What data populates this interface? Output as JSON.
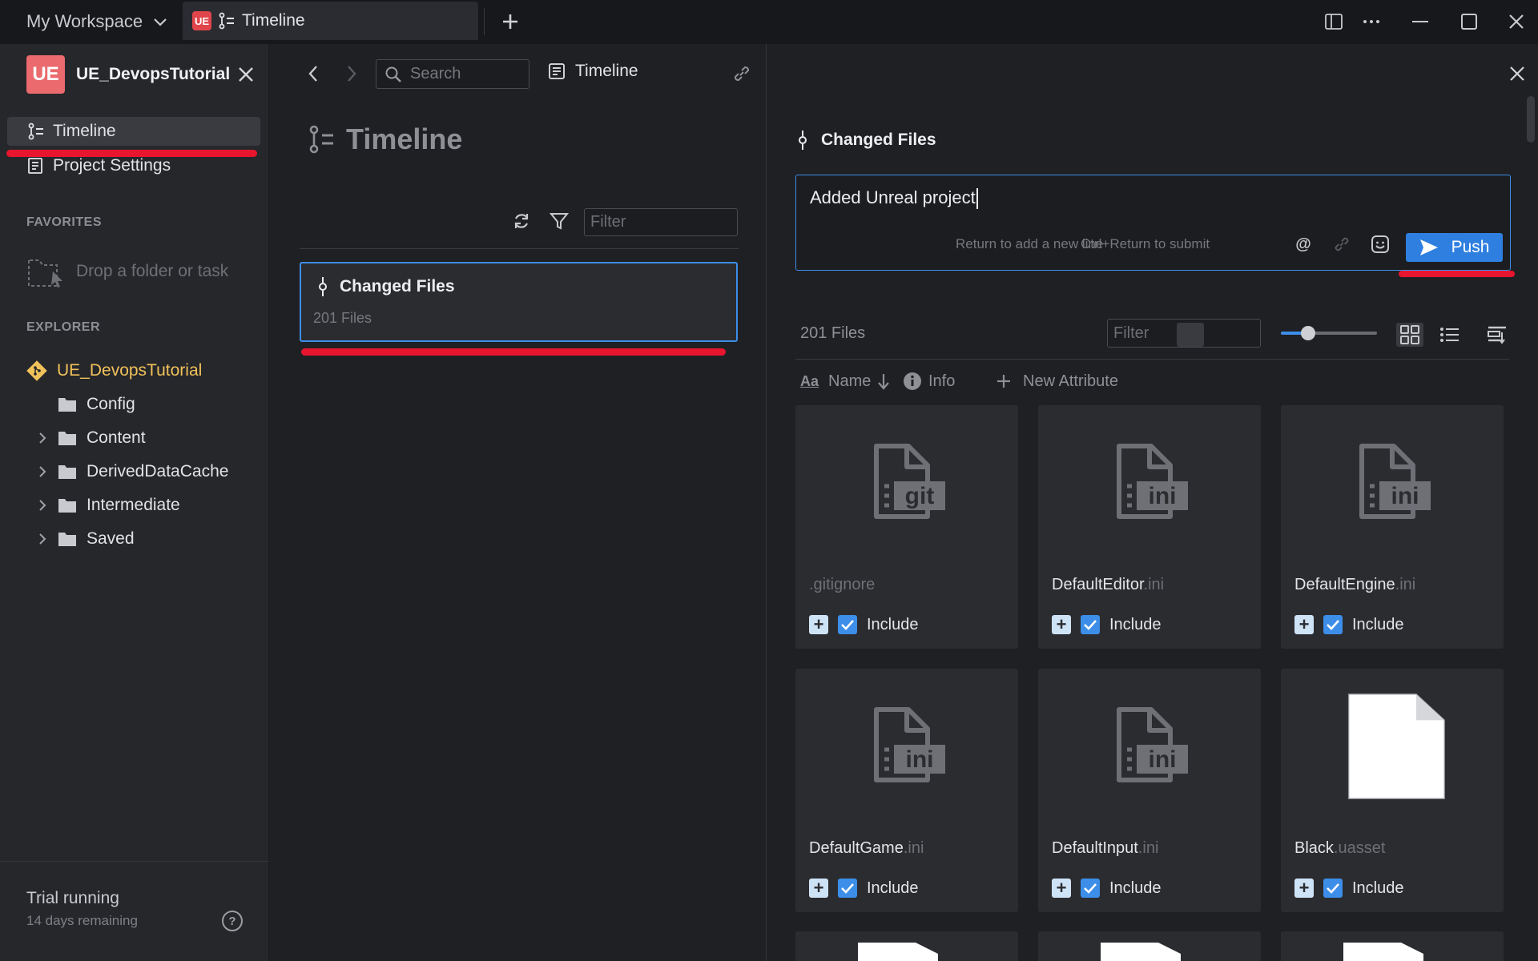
{
  "titlebar": {
    "workspace": "My Workspace",
    "tab_badge": "UE",
    "tab_title": "Timeline"
  },
  "sidebar": {
    "project_badge": "UE",
    "project_name": "UE_DevopsTutorial",
    "nav": [
      {
        "label": "Timeline"
      },
      {
        "label": "Project Settings"
      }
    ],
    "favorites_label": "FAVORITES",
    "drop_hint": "Drop a folder or task",
    "explorer_label": "EXPLORER",
    "tree": [
      {
        "label": "UE_DevopsTutorial"
      },
      {
        "label": "Config"
      },
      {
        "label": "Content"
      },
      {
        "label": "DerivedDataCache"
      },
      {
        "label": "Intermediate"
      },
      {
        "label": "Saved"
      }
    ],
    "trial_title": "Trial running",
    "trial_sub": "14 days remaining",
    "help_glyph": "?"
  },
  "middle": {
    "search_placeholder": "Search",
    "breadcrumb": "Timeline",
    "title": "Timeline",
    "filter_placeholder": "Filter",
    "card": {
      "title": "Changed Files",
      "subtitle": "201 Files"
    }
  },
  "right": {
    "title": "Changed Files",
    "commit_message": "Added Unreal project",
    "hint_newline": "Return to add a new line",
    "hint_submit": "Ctrl+Return to submit",
    "mention_glyph": "@",
    "push_label": "Push",
    "files_count": "201 Files",
    "filter_placeholder": "Filter",
    "zoom_level": 0.28,
    "attrs": {
      "aa": "Aa",
      "name": "Name",
      "info": "Info",
      "new_attribute": "New Attribute"
    },
    "files": [
      {
        "stem": ".gitignore",
        "ext": "",
        "badge": "git",
        "include_label": "Include"
      },
      {
        "stem": "DefaultEditor",
        "ext": ".ini",
        "badge": "ini",
        "include_label": "Include"
      },
      {
        "stem": "DefaultEngine",
        "ext": ".ini",
        "badge": "ini",
        "include_label": "Include"
      },
      {
        "stem": "DefaultGame",
        "ext": ".ini",
        "badge": "ini",
        "include_label": "Include"
      },
      {
        "stem": "DefaultInput",
        "ext": ".ini",
        "badge": "ini",
        "include_label": "Include"
      },
      {
        "stem": "Black",
        "ext": ".uasset",
        "badge": "",
        "include_label": "Include"
      }
    ]
  },
  "colors": {
    "accent": "#3c8ee8",
    "annotation_red": "#e8152e",
    "ue_badge": "#ea6a6e",
    "tree_root": "#f2c25a"
  }
}
